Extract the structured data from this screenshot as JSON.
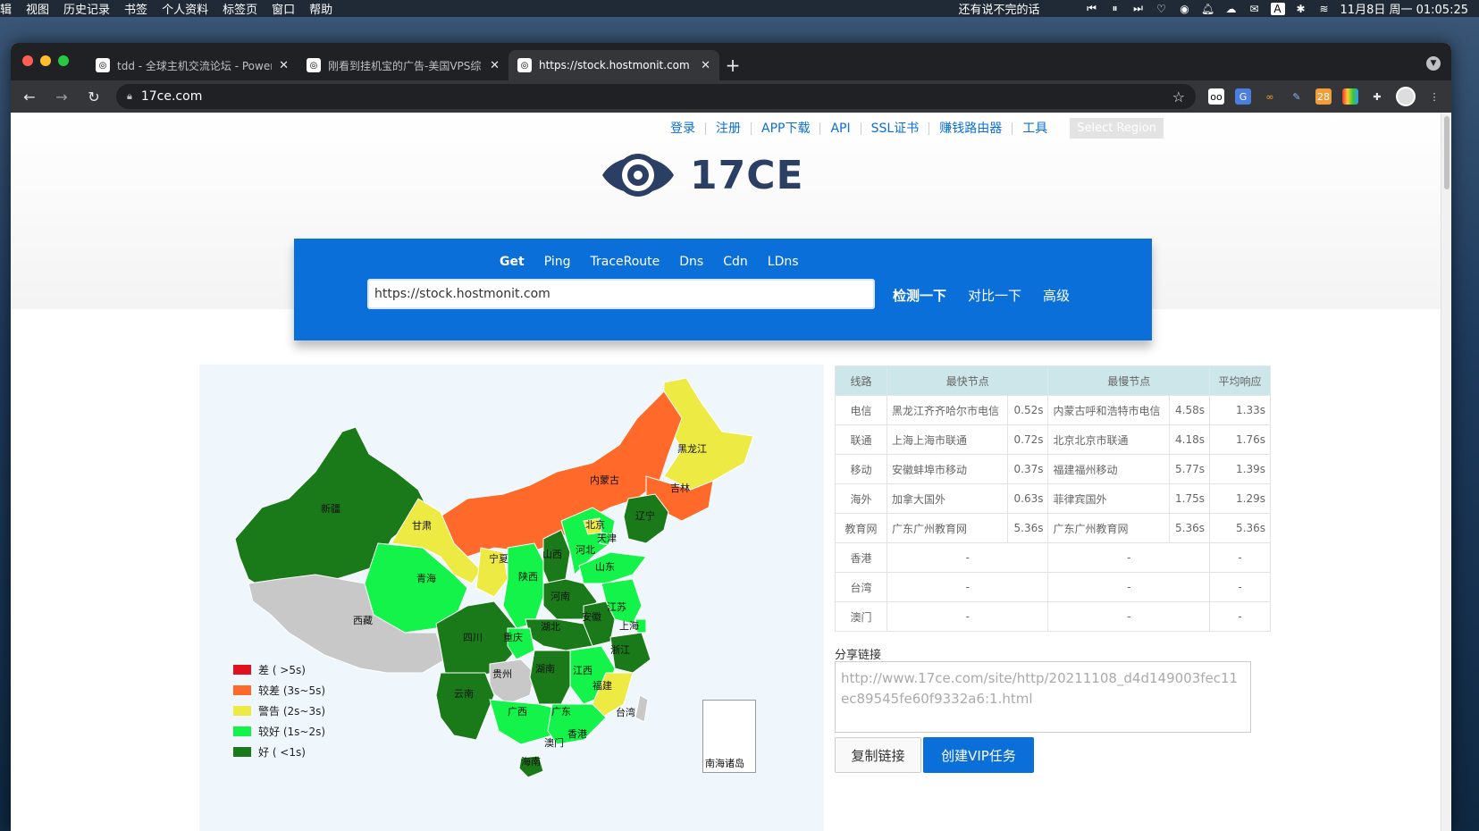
{
  "menubar": {
    "items": [
      "辑",
      "视图",
      "历史记录",
      "书签",
      "个人资料",
      "标签页",
      "窗口",
      "帮助"
    ],
    "now_playing": "还有说不完的话",
    "datetime": "11月8日 周一  01:05:25"
  },
  "browser": {
    "tabs": [
      {
        "title": "tdd - 全球主机交流论坛 - Power"
      },
      {
        "title": "刚看到挂机宝的广告-美国VPS综"
      },
      {
        "title": "https://stock.hostmonit.com Gl"
      }
    ],
    "url": "17ce.com"
  },
  "site": {
    "top_links": [
      "登录",
      "注册",
      "APP下载",
      "API",
      "SSL证书",
      "赚钱路由器",
      "工具"
    ],
    "region_select": "Select Region",
    "logo_text": "17CE",
    "search": {
      "tabs": [
        "Get",
        "Ping",
        "TraceRoute",
        "Dns",
        "Cdn",
        "LDns"
      ],
      "active_tab": "Get",
      "input_value": "https://stock.hostmonit.com",
      "check_button": "检测一下",
      "compare_button": "对比一下",
      "advanced": "高级"
    },
    "legend": [
      {
        "label": "差 ( >5s)",
        "color": "#e01020"
      },
      {
        "label": "较差 (3s~5s)",
        "color": "#ff6a2b"
      },
      {
        "label": "警告 (2s~3s)",
        "color": "#eeea44"
      },
      {
        "label": "较好 (1s~2s)",
        "color": "#13f34a"
      },
      {
        "label": "好 ( <1s)",
        "color": "#1a7a1a"
      }
    ],
    "map_labels": {
      "heilongjiang": "黑龙江",
      "jilin": "吉林",
      "liaoning": "辽宁",
      "neimenggu": "内蒙古",
      "xinjiang": "新疆",
      "gansu": "甘肃",
      "qinghai": "青海",
      "xizang": "西藏",
      "ningxia": "宁夏",
      "beijing": "北京",
      "tianjin": "天津",
      "hebei": "河北",
      "shanxi": "山西",
      "shandong": "山东",
      "shaanxi": "陕西",
      "henan": "河南",
      "jiangsu": "江苏",
      "anhui": "安徽",
      "shanghai": "上海",
      "hubei": "湖北",
      "sichuan": "四川",
      "chongqing": "重庆",
      "zhejiang": "浙江",
      "guizhou": "贵州",
      "hunan": "湖南",
      "jiangxi": "江西",
      "fujian": "福建",
      "yunnan": "云南",
      "guangxi": "广西",
      "guangdong": "广东",
      "taiwan": "台湾",
      "xianggang": "香港",
      "aomen": "澳门",
      "hainan": "海南",
      "nanhai": "南海诸岛"
    },
    "table": {
      "headers": [
        "线路",
        "最快节点",
        "最慢节点",
        "平均响应"
      ],
      "rows": [
        {
          "line": "电信",
          "fast_node": "黑龙江齐齐哈尔市电信",
          "fast_time": "0.52s",
          "slow_node": "内蒙古呼和浩特市电信",
          "slow_time": "4.58s",
          "avg": "1.33s"
        },
        {
          "line": "联通",
          "fast_node": "上海上海市联通",
          "fast_time": "0.72s",
          "slow_node": "北京北京市联通",
          "slow_time": "4.18s",
          "avg": "1.76s"
        },
        {
          "line": "移动",
          "fast_node": "安徽蚌埠市移动",
          "fast_time": "0.37s",
          "slow_node": "福建福州移动",
          "slow_time": "5.77s",
          "avg": "1.39s"
        },
        {
          "line": "海外",
          "fast_node": "加拿大国外",
          "fast_time": "0.63s",
          "slow_node": "菲律宾国外",
          "slow_time": "1.75s",
          "avg": "1.29s"
        },
        {
          "line": "教育网",
          "fast_node": "广东广州教育网",
          "fast_time": "5.36s",
          "slow_node": "广东广州教育网",
          "slow_time": "5.36s",
          "avg": "5.36s"
        },
        {
          "line": "香港",
          "fast_node": "-",
          "fast_time": "",
          "slow_node": "-",
          "slow_time": "",
          "avg": "-"
        },
        {
          "line": "台湾",
          "fast_node": "-",
          "fast_time": "",
          "slow_node": "-",
          "slow_time": "",
          "avg": "-"
        },
        {
          "line": "澳门",
          "fast_node": "-",
          "fast_time": "",
          "slow_node": "-",
          "slow_time": "",
          "avg": "-"
        }
      ]
    },
    "share": {
      "label": "分享链接",
      "url": "http://www.17ce.com/site/http/20211108_d4d149003fec11ec89545fe60f9332a6:1.html",
      "copy_button": "复制链接",
      "vip_button": "创建VIP任务"
    }
  }
}
